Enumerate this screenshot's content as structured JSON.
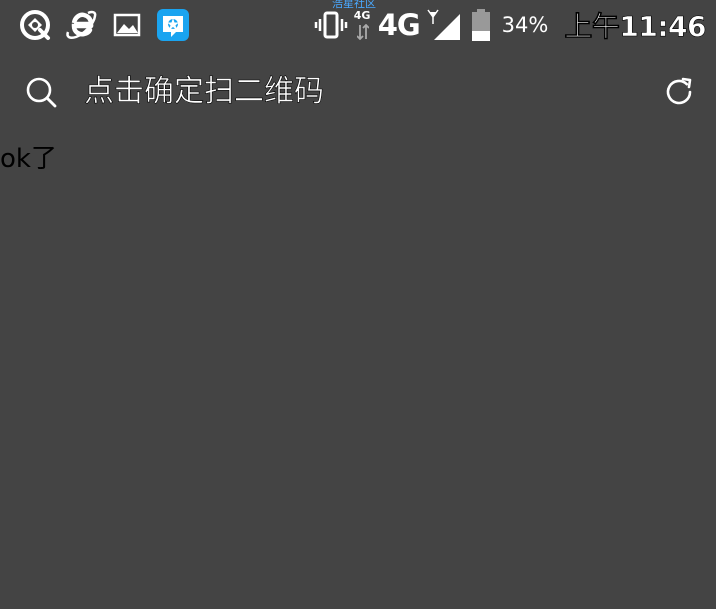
{
  "status_bar": {
    "watermark": "浩星社区",
    "network_small": "4G",
    "network_type": "4G",
    "battery_percent": "34%",
    "battery_level": 0.34,
    "time": "上午11:46",
    "left_icons": [
      "browser-compass-icon",
      "ie-browser-icon",
      "gallery-icon",
      "qq-messenger-icon"
    ]
  },
  "toolbar": {
    "title": "点击确定扫二维码"
  },
  "content": {
    "text": "ok了"
  },
  "colors": {
    "background": "#444444",
    "accent_app": "#1aa4f0",
    "watermark": "#4aa9ff"
  }
}
